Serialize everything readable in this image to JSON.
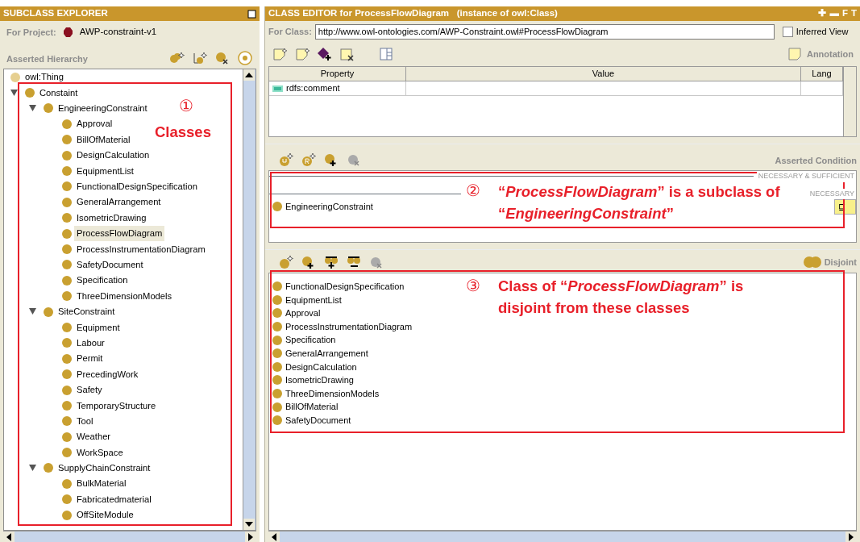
{
  "explorer": {
    "title": "SUBCLASS EXPLORER",
    "project_label": "For Project:",
    "project": "AWP-constraint-v1",
    "hierarchy_label": "Asserted Hierarchy",
    "tree": [
      {
        "label": "owl:Thing",
        "selected": false,
        "children": [
          {
            "label": "Constaint",
            "selected": false,
            "expanded": true,
            "children": [
              {
                "label": "EngineeringConstraint",
                "selected": false,
                "expanded": true,
                "children": [
                  {
                    "label": "Approval",
                    "selected": false
                  },
                  {
                    "label": "BillOfMaterial",
                    "selected": false
                  },
                  {
                    "label": "DesignCalculation",
                    "selected": false
                  },
                  {
                    "label": "EquipmentList",
                    "selected": false
                  },
                  {
                    "label": "FunctionalDesignSpecification",
                    "selected": false
                  },
                  {
                    "label": "GeneralArrangement",
                    "selected": false
                  },
                  {
                    "label": "IsometricDrawing",
                    "selected": false
                  },
                  {
                    "label": "ProcessFlowDiagram",
                    "selected": true
                  },
                  {
                    "label": "ProcessInstrumentationDiagram",
                    "selected": false
                  },
                  {
                    "label": "SafetyDocument",
                    "selected": false
                  },
                  {
                    "label": "Specification",
                    "selected": false
                  },
                  {
                    "label": "ThreeDimensionModels",
                    "selected": false
                  }
                ]
              },
              {
                "label": "SiteConstraint",
                "selected": false,
                "expanded": true,
                "children": [
                  {
                    "label": "Equipment",
                    "selected": false
                  },
                  {
                    "label": "Labour",
                    "selected": false
                  },
                  {
                    "label": "Permit",
                    "selected": false
                  },
                  {
                    "label": "PrecedingWork",
                    "selected": false
                  },
                  {
                    "label": "Safety",
                    "selected": false
                  },
                  {
                    "label": "TemporaryStructure",
                    "selected": false
                  },
                  {
                    "label": "Tool",
                    "selected": false
                  },
                  {
                    "label": "Weather",
                    "selected": false
                  },
                  {
                    "label": "WorkSpace",
                    "selected": false
                  }
                ]
              },
              {
                "label": "SupplyChainConstraint",
                "selected": false,
                "expanded": true,
                "children": [
                  {
                    "label": "BulkMaterial",
                    "selected": false
                  },
                  {
                    "label": "Fabricatedmaterial",
                    "selected": false
                  },
                  {
                    "label": "OffSiteModule",
                    "selected": false
                  }
                ]
              }
            ]
          }
        ]
      }
    ]
  },
  "editor": {
    "title": "CLASS EDITOR for ProcessFlowDiagram   (instance of owl:Class)",
    "title_buttons": [
      "✚",
      "▬",
      "F",
      "T"
    ],
    "for_class_label": "For Class:",
    "for_class_value": "http://www.owl-ontologies.com/AWP-Constraint.owl#ProcessFlowDiagram",
    "inferred_view": {
      "label": "Inferred View",
      "checked": false
    },
    "annotations_label": "Annotation",
    "table": {
      "columns": [
        "Property",
        "Value",
        "Lang"
      ],
      "rows": [
        {
          "property": "rdfs:comment"
        }
      ]
    },
    "conditions": {
      "label": "Asserted Condition",
      "headers": [
        "NECESSARY & SUFFICIENT",
        "NECESSARY"
      ],
      "items": [
        "EngineeringConstraint"
      ],
      "badge": "⊑"
    },
    "disjoints": {
      "label": "Disjoint",
      "items": [
        "FunctionalDesignSpecification",
        "EquipmentList",
        "Approval",
        "ProcessInstrumentationDiagram",
        "Specification",
        "GeneralArrangement",
        "DesignCalculation",
        "IsometricDrawing",
        "ThreeDimensionModels",
        "BillOfMaterial",
        "SafetyDocument"
      ]
    }
  },
  "callouts": [
    {
      "number": "①",
      "text": "Classes"
    },
    {
      "number": "②",
      "text": "“*ProcessFlowDiagram*” is a subclass of “*EngineeringConstraint*”"
    },
    {
      "number": "③",
      "text": "Class of “*ProcessFlowDiagram*” is disjoint from these classes"
    }
  ]
}
